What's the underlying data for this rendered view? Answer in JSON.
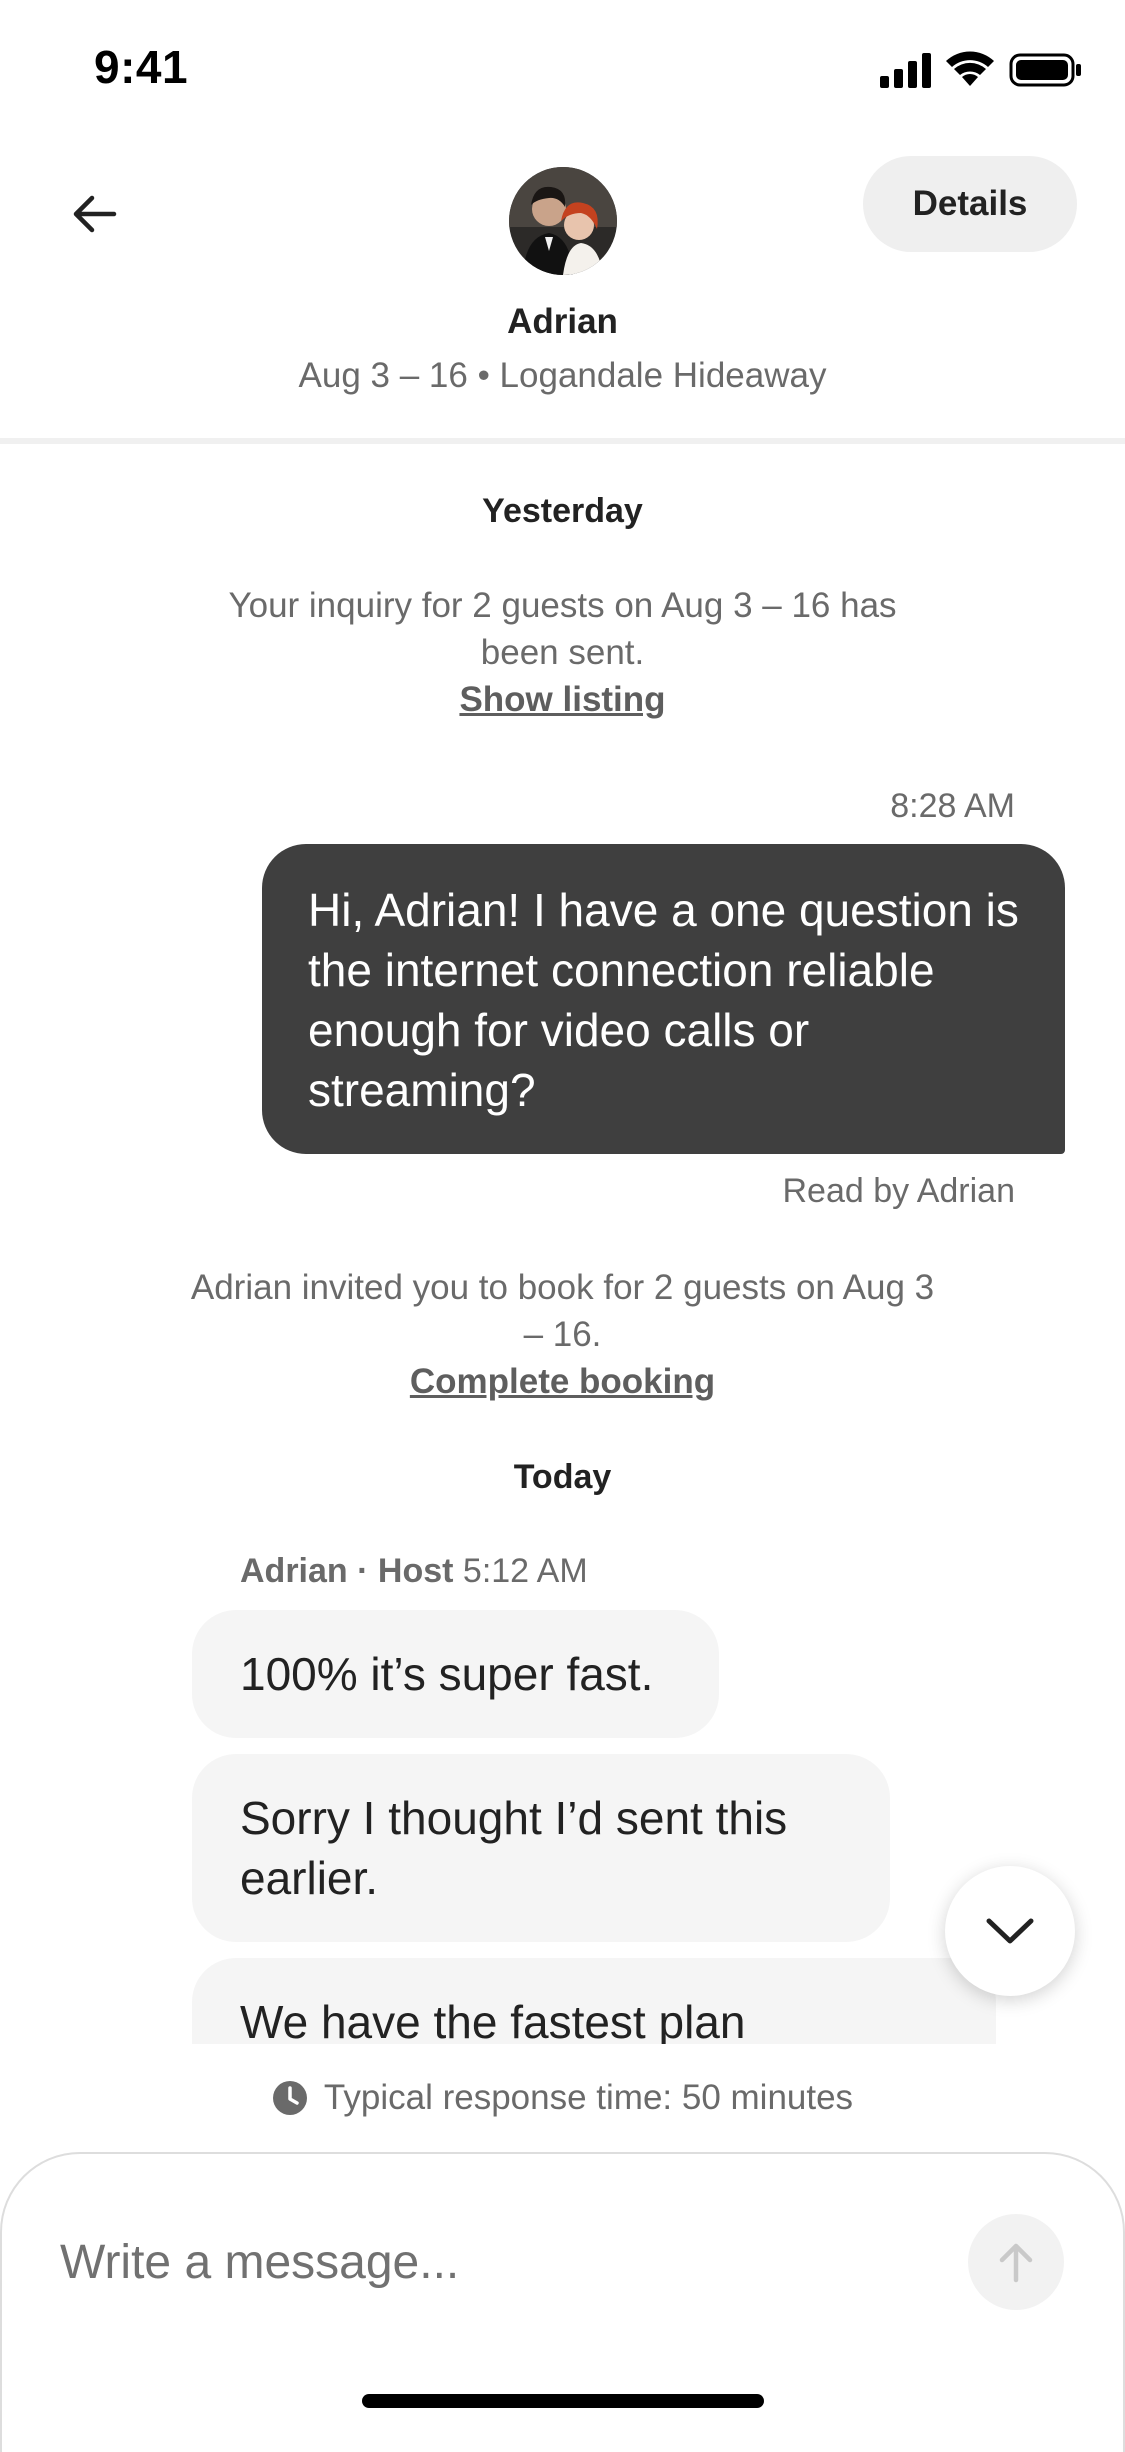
{
  "status_bar": {
    "time": "9:41"
  },
  "header": {
    "back_icon": "arrow-left-icon",
    "details_label": "Details",
    "host_name": "Adrian",
    "trip_info": "Aug 3 – 16 • Logandale Hideaway"
  },
  "thread": {
    "yesterday_label": "Yesterday",
    "inquiry_text": "Your inquiry for 2 guests on Aug 3 – 16 has been sent.",
    "show_listing_label": "Show listing",
    "sent_time": "8:28 AM",
    "sent_message": "Hi, Adrian! I have a one question is the internet connection reliable enough for video calls or streaming?",
    "read_receipt": "Read by Adrian",
    "invite_text": "Adrian invited you to book for 2 guests on Aug 3 – 16.",
    "complete_booking_label": "Complete booking",
    "today_label": "Today",
    "host_sender": "Adrian · Host",
    "host_time": "5:12 AM",
    "host_messages": [
      "100% it’s super fast.",
      "Sorry I thought I’d sent this earlier.",
      "We have the fastest plan"
    ]
  },
  "footer": {
    "response_time": "Typical response time: 50 minutes",
    "message_placeholder": "Write a message..."
  },
  "colors": {
    "sent_bubble": "#3f3f3f",
    "received_bubble": "#f5f5f5",
    "muted_text": "#6a6a6a"
  }
}
